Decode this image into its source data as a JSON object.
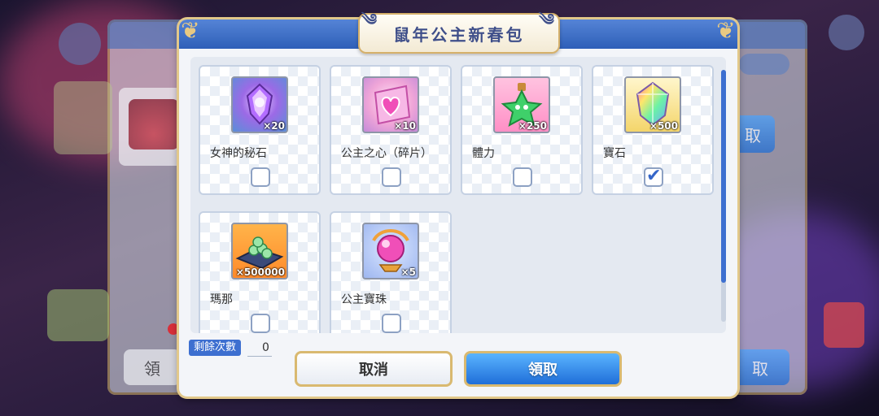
{
  "dialog": {
    "title": "鼠年公主新春包",
    "remaining_label": "剩餘次數",
    "remaining_value": "0",
    "cancel_label": "取消",
    "claim_label": "領取"
  },
  "items": [
    {
      "name": "女神的秘石",
      "qty": "×20",
      "checked": false,
      "icon": "goddess-stone-icon"
    },
    {
      "name": "公主之心（碎片）",
      "qty": "×10",
      "checked": false,
      "icon": "princess-heart-fragment-icon"
    },
    {
      "name": "體力",
      "qty": "×250",
      "checked": false,
      "icon": "stamina-potion-icon"
    },
    {
      "name": "寶石",
      "qty": "×500",
      "checked": true,
      "icon": "jewel-icon"
    },
    {
      "name": "瑪那",
      "qty": "×500000",
      "checked": false,
      "icon": "mana-icon"
    },
    {
      "name": "公主寶珠",
      "qty": "×5",
      "checked": false,
      "icon": "princess-orb-icon"
    }
  ],
  "background": {
    "right_button": "取",
    "bottom_right_button": "取",
    "bottom_left_button": "領"
  }
}
